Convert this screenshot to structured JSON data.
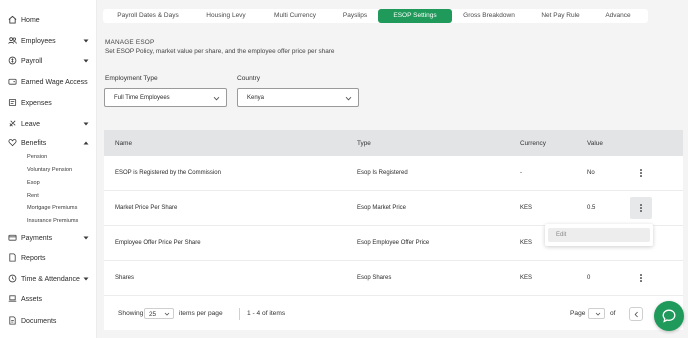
{
  "sidebar": {
    "items": [
      {
        "label": "Home",
        "icon": "home-icon",
        "has_chevron": false
      },
      {
        "label": "Employees",
        "icon": "people-icon",
        "has_chevron": true
      },
      {
        "label": "Payroll",
        "icon": "payroll-icon",
        "has_chevron": true
      },
      {
        "label": "Earned Wage Access",
        "icon": "wallet-icon",
        "has_chevron": false
      },
      {
        "label": "Expenses",
        "icon": "receipt-icon",
        "has_chevron": false
      },
      {
        "label": "Leave",
        "icon": "leave-icon",
        "has_chevron": true
      },
      {
        "label": "Benefits",
        "icon": "heart-icon",
        "has_chevron": true
      },
      {
        "label": "Payments",
        "icon": "card-icon",
        "has_chevron": true
      },
      {
        "label": "Reports",
        "icon": "document-icon",
        "has_chevron": false
      },
      {
        "label": "Time & Attendance",
        "icon": "clock-icon",
        "has_chevron": true
      },
      {
        "label": "Assets",
        "icon": "laptop-icon",
        "has_chevron": false
      },
      {
        "label": "Documents",
        "icon": "file-icon",
        "has_chevron": false
      }
    ],
    "benefits_sub": [
      "Pension",
      "Voluntary Pension",
      "Esop",
      "Rent",
      "Mortgage Premiums",
      "Insurance Premiums"
    ]
  },
  "tabs": [
    {
      "label": "Payroll Dates & Days",
      "active": false
    },
    {
      "label": "Housing Levy",
      "active": false
    },
    {
      "label": "Multi Currency",
      "active": false
    },
    {
      "label": "Payslips",
      "active": false
    },
    {
      "label": "ESOP Settings",
      "active": true
    },
    {
      "label": "Gross Breakdown",
      "active": false
    },
    {
      "label": "Net Pay Rule",
      "active": false
    },
    {
      "label": "Advance",
      "active": false
    }
  ],
  "section": {
    "title": "MANAGE ESOP",
    "subtitle": "Set ESOP Policy, market value per share, and the employee offer price per share"
  },
  "filters": {
    "employment_type_label": "Employment Type",
    "employment_type_value": "Full Time Employees",
    "country_label": "Country",
    "country_value": "Kenya"
  },
  "table": {
    "headers": {
      "name": "Name",
      "type": "Type",
      "currency": "Currency",
      "value": "Value"
    },
    "rows": [
      {
        "name": "ESOP is Registered by the Commission",
        "type": "Esop Is Registered",
        "currency": "-",
        "value": "No"
      },
      {
        "name": "Market Price Per Share",
        "type": "Esop Market Price",
        "currency": "KES",
        "value": "0.5"
      },
      {
        "name": "Employee Offer Price Per Share",
        "type": "Esop Employee Offer Price",
        "currency": "KES",
        "value": ""
      },
      {
        "name": "Shares",
        "type": "Esop Shares",
        "currency": "KES",
        "value": "0"
      }
    ],
    "row_menu": {
      "edit_label": "Edit"
    }
  },
  "footer": {
    "showing_label": "Showing",
    "per_page_value": "25",
    "per_page_suffix": "items per page",
    "range_text": "1 - 4 of items",
    "page_label": "Page",
    "page_value": "",
    "of_label": "of"
  },
  "colors": {
    "accent": "#1f9a5a",
    "header_bg": "#e3e4e6"
  }
}
